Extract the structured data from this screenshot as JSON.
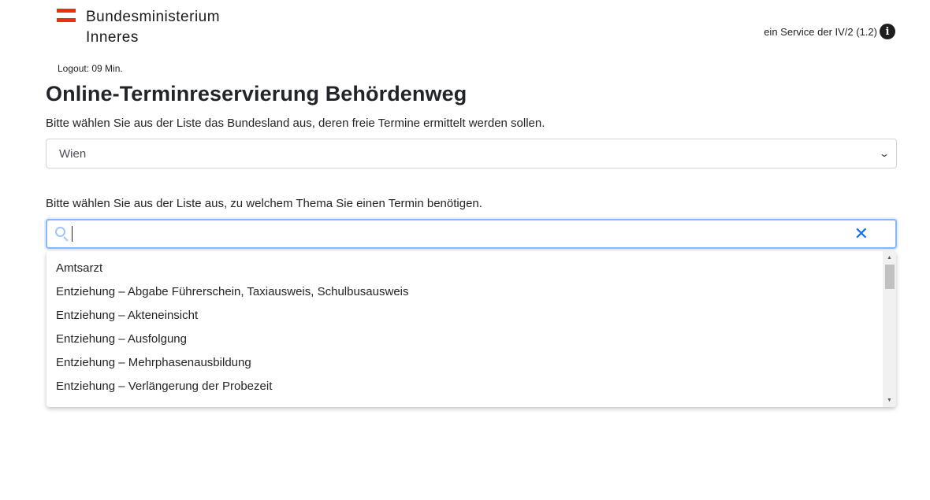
{
  "header": {
    "logo_line1": "Bundesministerium",
    "logo_line2": "Inneres",
    "service_text": "ein Service der IV/2 (1.2)",
    "info_icon_glyph": "i"
  },
  "session": {
    "logout": "Logout: 09 Min."
  },
  "page": {
    "title": "Online-Terminreservierung Behördenweg",
    "state_prompt": "Bitte wählen Sie aus der Liste das Bundesland aus, deren freie Termine ermittelt werden sollen.",
    "state_selected": "Wien",
    "topic_prompt": "Bitte wählen Sie aus der Liste aus, zu welchem Thema Sie einen Termin benötigen.",
    "topic_search_value": ""
  },
  "dropdown": {
    "options": [
      "Amtsarzt",
      "Entziehung – Abgabe Führerschein, Taxiausweis, Schulbusausweis",
      "Entziehung – Akteneinsicht",
      "Entziehung – Ausfolgung",
      "Entziehung – Mehrphasenausbildung",
      "Entziehung – Verlängerung der Probezeit"
    ]
  },
  "colors": {
    "flag_red": "#e6320f",
    "focus_border": "#86b7fe",
    "clear_icon": "#0d6efd"
  },
  "icons": {
    "search": "search-icon",
    "clear": "close-icon",
    "chevron": "chevron-down-icon",
    "info": "info-icon"
  }
}
